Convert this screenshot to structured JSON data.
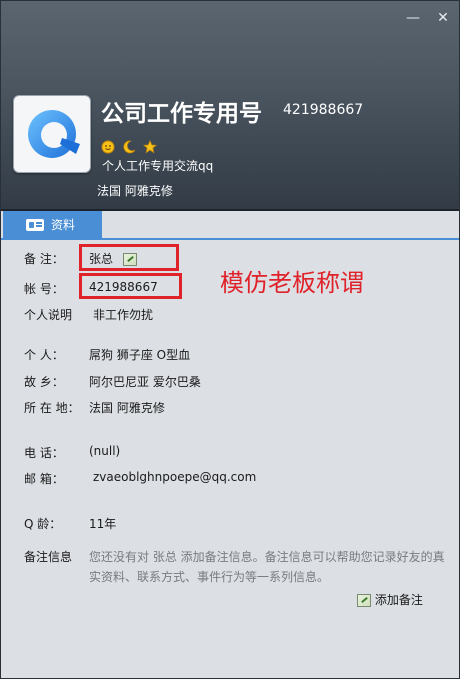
{
  "window": {
    "minimize": "—",
    "close": "✕"
  },
  "profile": {
    "name": "公司工作专用号",
    "qq_number": "421988667",
    "signature": "个人工作专用交流qq",
    "location": "法国 阿雅克修",
    "level_icons": [
      "sun-icon",
      "moon-icon",
      "star-icon"
    ]
  },
  "tab": {
    "label": "资料"
  },
  "fields": {
    "remark_label": "备    注：",
    "remark_value": "张总",
    "account_label": "帐    号：",
    "account_value": "421988667",
    "desc_label": "个人说明",
    "desc_value": "非工作勿扰",
    "person_label": "个    人：",
    "person_value": "屌狗   狮子座   O型血",
    "hometown_label": "故    乡：",
    "hometown_value": "阿尔巴尼亚 爱尔巴桑",
    "location_label": "所 在 地：",
    "location_value": "法国 阿雅克修",
    "phone_label": "电    话：",
    "phone_value": "(null)",
    "email_label": "邮    箱：",
    "email_value": "zvaeoblghnpoepe@qq.com",
    "age_label": "Q      龄：",
    "age_value": "11年",
    "note_label": "备注信息",
    "note_text": "您还没有对 张总 添加备注信息。备注信息可以帮助您记录好友的真实资料、联系方式、事件行为等一系列信息。",
    "add_note": "添加备注"
  },
  "annotation": "模仿老板称谓",
  "colors": {
    "accent": "#4a8fd6",
    "annotation_red": "#e0222a"
  }
}
